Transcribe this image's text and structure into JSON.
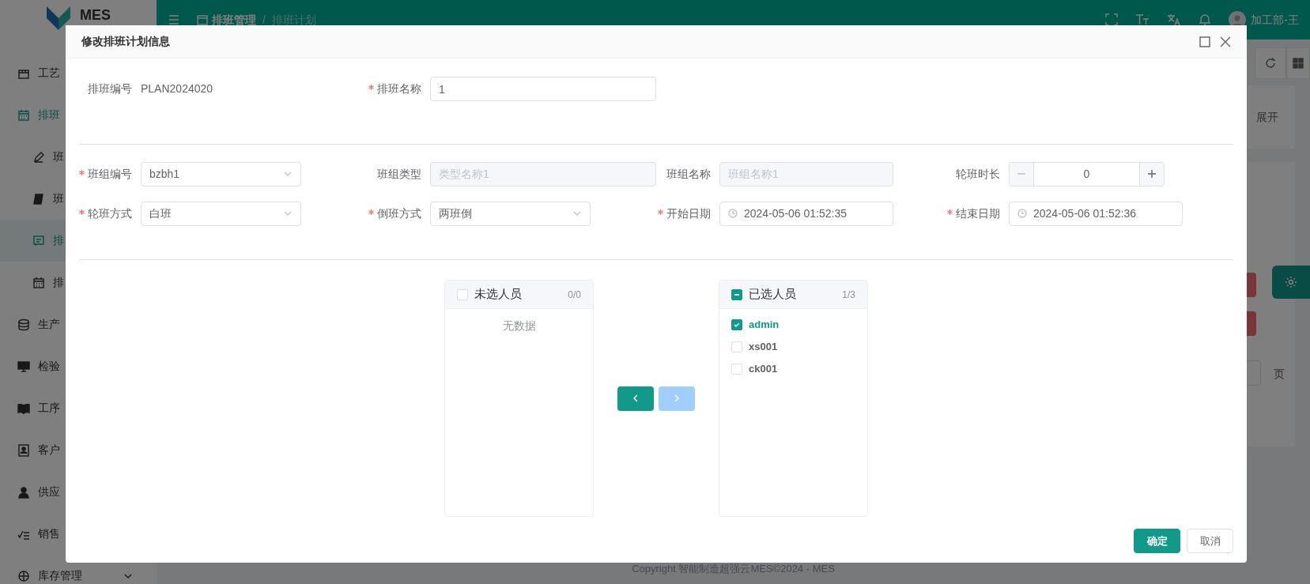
{
  "app": {
    "logo_text": "MES",
    "breadcrumb": [
      "排班管理",
      "排班计划"
    ],
    "breadcrumb_separator": "/",
    "user": "加工部-王",
    "sidebar": [
      {
        "label": "工艺"
      },
      {
        "label": "排班",
        "expanded": true,
        "children": [
          {
            "label": "班",
            "selected": false
          },
          {
            "label": "班",
            "selected": false
          },
          {
            "label": "排",
            "selected": true
          },
          {
            "label": "排",
            "selected": false
          }
        ]
      },
      {
        "label": "生产"
      },
      {
        "label": "检验"
      },
      {
        "label": "工序"
      },
      {
        "label": "客户"
      },
      {
        "label": "供应"
      },
      {
        "label": "销售"
      },
      {
        "label": "库存管理",
        "expanded": false
      }
    ],
    "background_texts": {
      "toggle": "展开",
      "pager_suffix": "页"
    },
    "footer": "Copyright 智能制造超强云MES©2024 - MES"
  },
  "dialog": {
    "title": "修改排班计划信息",
    "rows": [
      [
        {
          "label": "排班编号",
          "kind": "text",
          "value": "PLAN2024020",
          "required": false
        },
        {
          "label": "排班名称",
          "kind": "input",
          "value": "1",
          "required": true
        }
      ],
      [
        {
          "label": "班组编号",
          "kind": "select",
          "value": "bzbh1",
          "required": true
        },
        {
          "label": "班组类型",
          "kind": "input",
          "placeholder": "类型名称1",
          "disabled": true,
          "required": false
        },
        {
          "label": "班组名称",
          "kind": "input",
          "placeholder": "班组名称1",
          "disabled": true,
          "required": false
        },
        {
          "label": "轮班时长",
          "kind": "number",
          "value": "0",
          "required": false
        }
      ],
      [
        {
          "label": "轮班方式",
          "kind": "select",
          "value": "白班",
          "required": true
        },
        {
          "label": "倒班方式",
          "kind": "select",
          "value": "两班倒",
          "required": true
        },
        {
          "label": "开始日期",
          "kind": "datetime",
          "value": "2024-05-06 01:52:35",
          "required": true
        },
        {
          "label": "结束日期",
          "kind": "datetime",
          "value": "2024-05-06 01:52:36",
          "required": true
        }
      ]
    ],
    "transfer": {
      "left": {
        "title": "未选人员",
        "count": "0/0",
        "check_all_checked": false,
        "check_all_indeterminate": false,
        "empty_text": "无数据"
      },
      "right": {
        "title": "已选人员",
        "count": "1/3",
        "check_all_checked": false,
        "check_all_indeterminate": true,
        "items": [
          {
            "label": "admin",
            "checked": true
          },
          {
            "label": "xs001",
            "checked": false
          },
          {
            "label": "ck001",
            "checked": false
          }
        ]
      },
      "buttons": [
        {
          "kind": "move_left",
          "disabled": false
        },
        {
          "kind": "move_right",
          "disabled": true
        }
      ]
    },
    "buttons": [
      {
        "label": "确定",
        "kind": "primary"
      },
      {
        "label": "取消",
        "kind": "default"
      }
    ]
  }
}
